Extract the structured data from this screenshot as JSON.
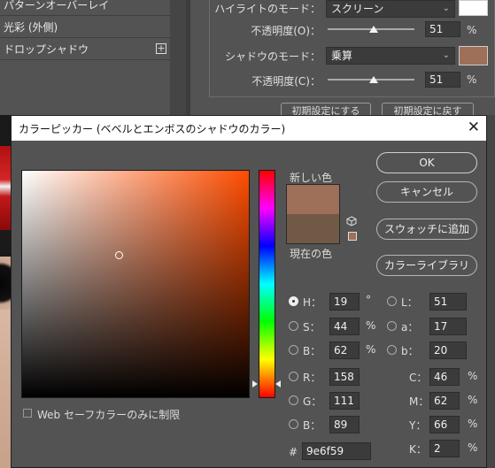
{
  "background_panel": {
    "left_items": [
      "パターンオーバーレイ",
      "光彩 (外側)",
      "ドロップシャドウ"
    ],
    "plus_glyph": "+",
    "highlight_mode_label": "ハイライトのモード：",
    "highlight_mode_value": "スクリーン",
    "opacity_label_1": "不透明度(O)：",
    "opacity_value_1": "51",
    "shadow_mode_label": "シャドウのモード：",
    "shadow_mode_value": "乗算",
    "opacity_label_2": "不透明度(C)：",
    "opacity_value_2": "51",
    "percent": "%",
    "reset_default_button": "初期設定にする",
    "restore_default_button": "初期設定に戻す",
    "highlight_color": "#ffffff",
    "shadow_color": "#9e6f59"
  },
  "dialog": {
    "title": "カラーピッカー (ベベルとエンボスのシャドウのカラー)",
    "close_glyph": "✕",
    "new_label": "新しい色",
    "current_label": "現在の色",
    "new_color": "#9e6f59",
    "current_color": "#705a46",
    "buttons": {
      "ok": "OK",
      "cancel": "キャンセル",
      "add_swatch": "スウォッチに追加",
      "color_library": "カラーライブラリ"
    },
    "web_safe_label": "Web セーフカラーのみに制限",
    "hsb": {
      "h_label": "H：",
      "h_value": "19",
      "h_unit": "°",
      "s_label": "S：",
      "s_value": "44",
      "s_unit": "%",
      "b_label": "B：",
      "b_value": "62",
      "b_unit": "%"
    },
    "rgb": {
      "r_label": "R：",
      "r_value": "158",
      "g_label": "G：",
      "g_value": "111",
      "b_label": "B：",
      "b_value": "89"
    },
    "lab": {
      "l_label": "L：",
      "l_value": "51",
      "a_label": "a：",
      "a_value": "17",
      "b_label": "b：",
      "b_value": "20"
    },
    "cmyk": {
      "c_label": "C：",
      "c_value": "46",
      "m_label": "M：",
      "m_value": "62",
      "y_label": "Y：",
      "y_value": "66",
      "k_label": "K：",
      "k_value": "2",
      "unit": "%"
    },
    "hex_label": "#",
    "hex_value": "9e6f59",
    "selected_mode": "H"
  }
}
